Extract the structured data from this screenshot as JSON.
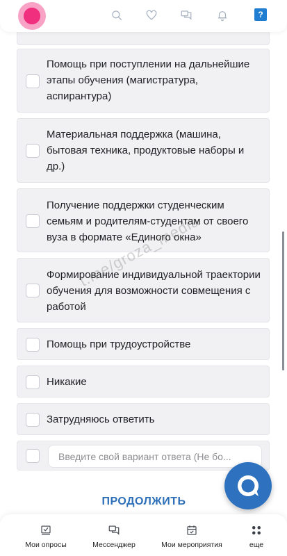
{
  "header": {
    "icons": [
      "search-icon",
      "heart-icon",
      "messages-icon",
      "bell-icon",
      "help-icon"
    ],
    "help_label": "?"
  },
  "options": [
    {
      "label": ""
    },
    {
      "label": "Помощь при поступлении на дальнейшие этапы обучения (магистратура, аспирантура)"
    },
    {
      "label": "Материальная поддержка (машина, бытовая техника, продуктовые наборы и др.)"
    },
    {
      "label": "Получение поддержки студенческим семьям и родителям-студентам от своего вуза в формате «Единого окна»"
    },
    {
      "label": "Формирование индивидуальной траектории обучения для возможности совмещения с работой"
    },
    {
      "label": "Помощь при трудоустройстве"
    },
    {
      "label": "Никакие"
    },
    {
      "label": "Затрудняюсь ответить"
    }
  ],
  "custom_answer": {
    "placeholder": "Введите свой вариант ответа (Не бо...",
    "value": ""
  },
  "continue_label": "ПРОДОЛЖИТЬ",
  "watermark": "t.me/groza_media",
  "bottom_nav": [
    {
      "label": "Мои опросы",
      "icon": "survey-icon"
    },
    {
      "label": "Мессенджер",
      "icon": "messenger-icon"
    },
    {
      "label": "Мои мероприятия",
      "icon": "calendar-icon"
    },
    {
      "label": "еще",
      "icon": "more-icon"
    }
  ],
  "colors": {
    "accent": "#2d6fb8",
    "fab": "#2d71bf",
    "option_bg": "#f1f1f3",
    "touch_indicator": "#f0307e"
  }
}
